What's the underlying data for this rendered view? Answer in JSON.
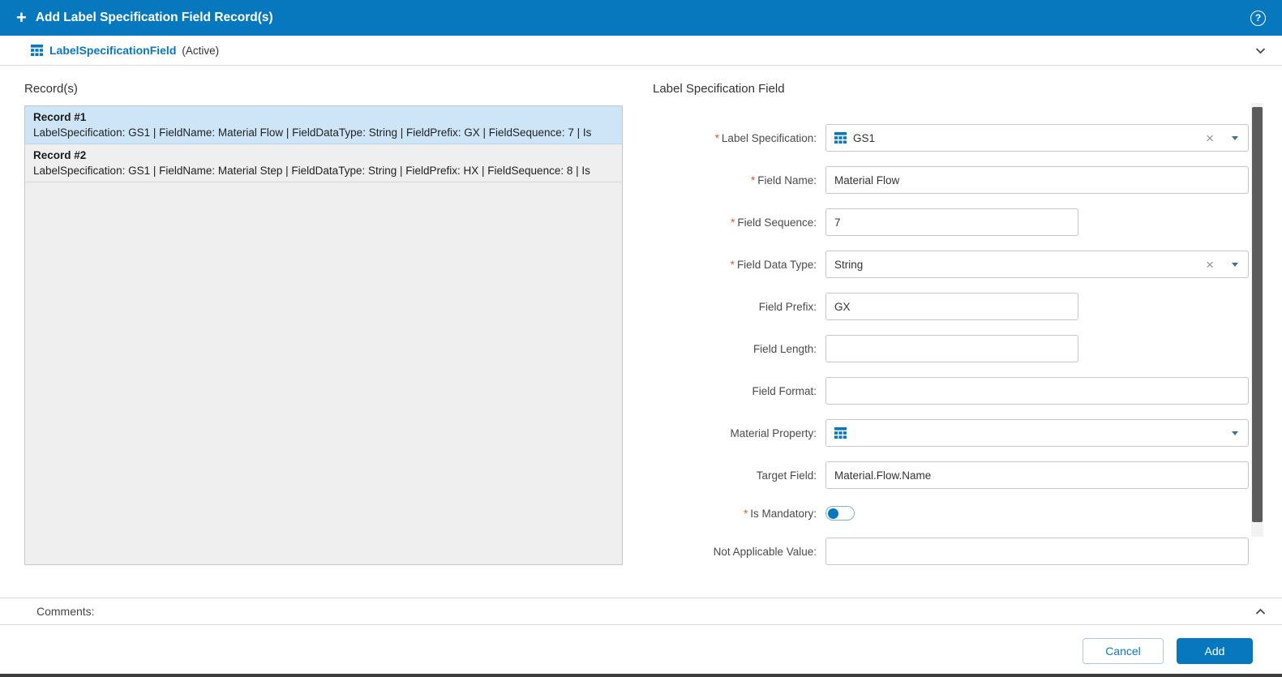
{
  "colors": {
    "primary": "#0878be",
    "selected_record_bg": "#cde5f7",
    "required_marker": "#e0552e"
  },
  "icons": {
    "add": "+",
    "help": "?",
    "clear": "×",
    "required": "*"
  },
  "header": {
    "title": "Add Label Specification Field Record(s)"
  },
  "subheader": {
    "entity_name": "LabelSpecificationField",
    "status": "(Active)"
  },
  "records_panel": {
    "title": "Record(s)",
    "records": [
      {
        "title": "Record #1",
        "summary": "LabelSpecification: GS1 | FieldName: Material Flow | FieldDataType: String | FieldPrefix: GX | FieldSequence: 7 | Is",
        "selected": true
      },
      {
        "title": "Record #2",
        "summary": "LabelSpecification: GS1 | FieldName: Material Step | FieldDataType: String | FieldPrefix: HX | FieldSequence: 8 | Is",
        "selected": false
      }
    ]
  },
  "form": {
    "title": "Label Specification Field",
    "fields": {
      "label_specification": {
        "label": "Label Specification:",
        "required": true,
        "type": "lookup",
        "value": "GS1"
      },
      "field_name": {
        "label": "Field Name:",
        "required": true,
        "type": "text",
        "value": "Material Flow"
      },
      "field_sequence": {
        "label": "Field Sequence:",
        "required": true,
        "type": "number",
        "value": "7"
      },
      "field_data_type": {
        "label": "Field Data Type:",
        "required": true,
        "type": "select",
        "value": "String"
      },
      "field_prefix": {
        "label": "Field Prefix:",
        "required": false,
        "type": "text",
        "value": "GX"
      },
      "field_length": {
        "label": "Field Length:",
        "required": false,
        "type": "number",
        "value": ""
      },
      "field_format": {
        "label": "Field Format:",
        "required": false,
        "type": "text",
        "value": ""
      },
      "material_property": {
        "label": "Material Property:",
        "required": false,
        "type": "lookup",
        "value": ""
      },
      "target_field": {
        "label": "Target Field:",
        "required": false,
        "type": "text",
        "value": "Material.Flow.Name"
      },
      "is_mandatory": {
        "label": "Is Mandatory:",
        "required": true,
        "type": "toggle",
        "value": false
      },
      "not_applicable_value": {
        "label": "Not Applicable Value:",
        "required": false,
        "type": "text",
        "value": ""
      }
    }
  },
  "comments": {
    "label": "Comments:"
  },
  "footer": {
    "cancel_label": "Cancel",
    "add_label": "Add"
  }
}
